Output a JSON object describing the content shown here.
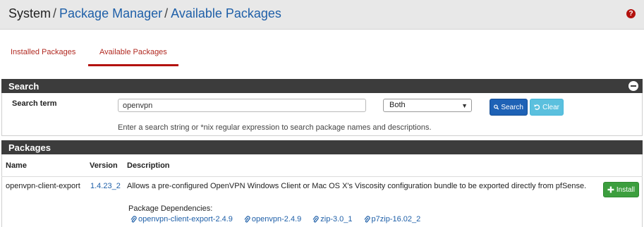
{
  "breadcrumb": {
    "root": "System",
    "separator": "/",
    "level2": "Package Manager",
    "level3": "Available Packages"
  },
  "help_icon": "question-icon",
  "tabs": [
    {
      "label": "Installed Packages",
      "active": false
    },
    {
      "label": "Available Packages",
      "active": true
    }
  ],
  "search": {
    "heading": "Search",
    "term_label": "Search term",
    "term_value": "openvpn",
    "scope_selected": "Both",
    "search_button": "Search",
    "clear_button": "Clear",
    "help_text": "Enter a search string or *nix regular expression to search package names and descriptions."
  },
  "packages": {
    "heading": "Packages",
    "columns": {
      "name": "Name",
      "version": "Version",
      "description": "Description"
    },
    "rows": [
      {
        "name": "openvpn-client-export",
        "version": "1.4.23_2",
        "description": "Allows a pre-configured OpenVPN Windows Client or Mac OS X's Viscosity configuration bundle to be exported directly from pfSense.",
        "dependencies_label": "Package Dependencies:",
        "dependencies": [
          "openvpn-client-export-2.4.9",
          "openvpn-2.4.9",
          "zip-3.0_1",
          "p7zip-16.02_2"
        ],
        "install_button": "Install"
      }
    ]
  },
  "colors": {
    "accent_red": "#b3120e",
    "link_blue": "#1e5fa8",
    "heading_bg": "#3c3c3c",
    "search_button": "#1e62b6",
    "clear_button": "#5bc0de",
    "install_button": "#3c9e3e"
  }
}
